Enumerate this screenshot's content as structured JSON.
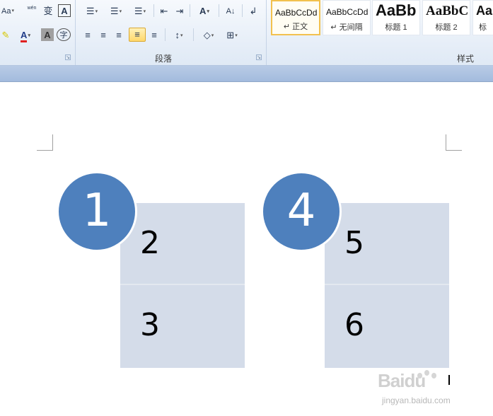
{
  "ribbon": {
    "paragraph_group_label": "段落",
    "styles_group_label": "样式",
    "launcher_glyph": "↘",
    "font_tools": {
      "change_case": "Aa",
      "phonetic_top": "wén",
      "phonetic_char": "变",
      "char_border": "A",
      "font_color": "A",
      "char_shading": "A",
      "enclose_char": "字"
    },
    "paragraph_tools": {
      "bullets": "☰",
      "numbering": "☰",
      "multilevel": "☰",
      "decrease_indent": "⇤",
      "increase_indent": "⇥",
      "chinese_layout": "A",
      "sort": "A↓",
      "show_marks": "↲",
      "align_left": "≡",
      "align_center": "≡",
      "align_right": "≡",
      "justify": "≡",
      "distributed": "≡",
      "line_spacing": "↕",
      "shading": "◇",
      "borders": "⊞"
    },
    "styles": [
      {
        "sample": "AaBbCcDd",
        "name": "↵ 正文",
        "selected": true
      },
      {
        "sample": "AaBbCcDd",
        "name": "↵ 无间隔",
        "selected": false
      },
      {
        "sample": "AaBb",
        "name": "标题 1",
        "selected": false
      },
      {
        "sample": "AaBbC",
        "name": "标题 2",
        "selected": false
      },
      {
        "sample": "Aa",
        "name": "标",
        "selected": false
      }
    ]
  },
  "document": {
    "circles": [
      "1",
      "4"
    ],
    "cells": [
      "2",
      "3",
      "5",
      "6"
    ]
  },
  "colors": {
    "circle_fill": "#4e80bd",
    "cell_fill": "#d4dce9",
    "ribbon_bg": "#dfe9f5"
  },
  "watermark": {
    "logo": "Baidu",
    "site": "jingyan.baidu.com"
  }
}
